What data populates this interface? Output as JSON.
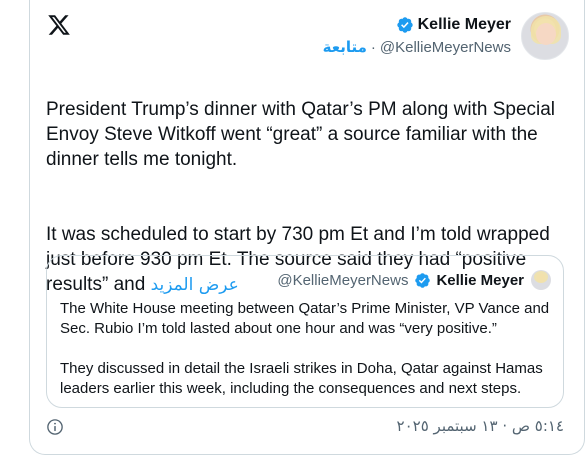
{
  "tweet": {
    "author": {
      "display_name": "Kellie Meyer",
      "handle": "@KellieMeyerNews",
      "follow_label": "متابعة",
      "separator": "·",
      "verified_icon": "verified-badge-icon",
      "avatar": "profile-photo"
    },
    "text_p1": "President Trump’s dinner with Qatar’s PM along with Special Envoy Steve Witkoff went “great” a source familiar with the dinner tells me tonight.",
    "text_p2": "It was scheduled to start by 730 pm Et and I’m told wrapped just before 930 pm Et. The source said they had “positive results” and",
    "show_more": "عرض المزيد",
    "quoted": {
      "display_name": "Kellie Meyer",
      "handle": "@KellieMeyerNews",
      "p1": "The White House meeting between Qatar’s Prime Minister, VP Vance and Sec. Rubio I’m told lasted about one hour and was “very positive.”",
      "p2": "They discussed in detail the Israeli strikes in Doha, Qatar against Hamas leaders earlier this week, including the consequences and next steps."
    },
    "timestamp": "٥:١٤ ص · ١٣ سبتمبر ٢٠٢٥",
    "icons": {
      "logo": "x-logo-icon",
      "info": "info-icon"
    },
    "colors": {
      "accent": "#1d9bf0",
      "text": "#0f1419",
      "muted": "#536471",
      "border": "#cfd9de"
    }
  }
}
